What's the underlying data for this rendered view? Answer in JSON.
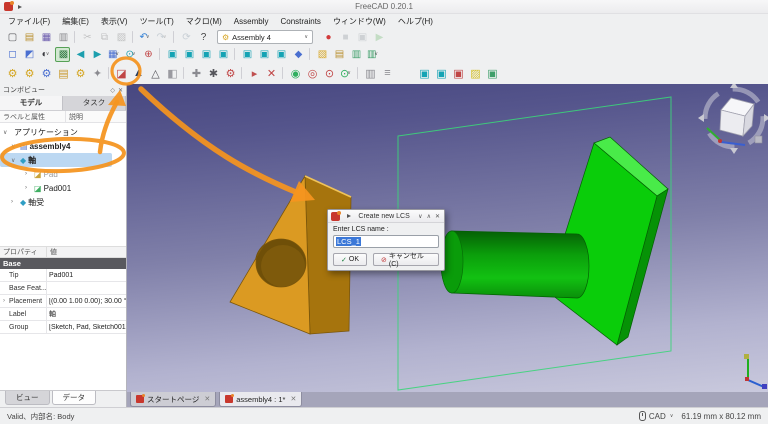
{
  "window": {
    "title": "FreeCAD 0.20.1"
  },
  "menu_bar": {
    "items": [
      {
        "name": "menu-file",
        "label": "ファイル(F)"
      },
      {
        "name": "menu-edit",
        "label": "編集(E)"
      },
      {
        "name": "menu-view",
        "label": "表示(V)"
      },
      {
        "name": "menu-tools",
        "label": "ツール(T)"
      },
      {
        "name": "menu-macro",
        "label": "マクロ(M)"
      },
      {
        "name": "menu-assembly",
        "label": "Assembly"
      },
      {
        "name": "menu-constraints",
        "label": "Constraints"
      },
      {
        "name": "menu-windows",
        "label": "ウィンドウ(W)"
      },
      {
        "name": "menu-help",
        "label": "ヘルプ(H)"
      }
    ]
  },
  "toolbars": {
    "workbench_selector": {
      "value": "Assembly 4",
      "icon_glyph": "⚙",
      "chevron": "∨"
    },
    "row1a": [
      {
        "name": "new-file-button",
        "glyph": "▢",
        "color": "#5a5a5e"
      },
      {
        "name": "open-file-button",
        "glyph": "▤",
        "color": "#b98f2e"
      },
      {
        "name": "save-button",
        "glyph": "▦",
        "color": "#6a5aad"
      },
      {
        "name": "print-button",
        "glyph": "▥",
        "color": "#8a8a8e"
      },
      {
        "cls": "tsep"
      },
      {
        "name": "cut-button",
        "glyph": "✂",
        "color": "#777777",
        "cls": "dim"
      },
      {
        "name": "copy-button",
        "glyph": "⧉",
        "color": "#777777",
        "cls": "dim"
      },
      {
        "name": "paste-button",
        "glyph": "▨",
        "color": "#777777",
        "cls": "dim"
      },
      {
        "cls": "tsep"
      },
      {
        "name": "undo-button",
        "glyph": "↶",
        "color": "#2f7fd6",
        "dd": "∨"
      },
      {
        "name": "redo-button",
        "glyph": "↷",
        "color": "#8a9aa8",
        "cls": "dim",
        "dd": "∨"
      },
      {
        "cls": "tsep"
      },
      {
        "name": "refresh-button",
        "glyph": "⟳",
        "color": "#8a9aa8",
        "cls": "dim"
      },
      {
        "name": "whats-this-button",
        "glyph": "?",
        "color": "#444444"
      }
    ],
    "row1b": [
      {
        "name": "macro-record-button",
        "glyph": "●",
        "color": "#d23b3b"
      },
      {
        "name": "macro-stop-button",
        "glyph": "■",
        "color": "#9aa0a6",
        "cls": "dim"
      },
      {
        "name": "macro-debug-button",
        "glyph": "▣",
        "color": "#9aa0a6",
        "cls": "dim"
      },
      {
        "name": "macro-play-button",
        "glyph": "▶",
        "color": "#7fbf7f",
        "cls": "dim"
      }
    ],
    "row2": [
      {
        "name": "box-selection-button",
        "glyph": "◻",
        "color": "#4a6fd0"
      },
      {
        "name": "box-element-selection-button",
        "glyph": "◩",
        "color": "#4a6fd0"
      },
      {
        "name": "draw-style-button",
        "glyph": "◐",
        "color": "#3a3a40",
        "dd": "∨"
      },
      {
        "name": "textured-view-button",
        "glyph": "▩",
        "color": "#3a7f4a",
        "cls": "isel"
      },
      {
        "name": "nav-back-button",
        "glyph": "◀",
        "color": "#1d9fae"
      },
      {
        "name": "nav-forward-button",
        "glyph": "▶",
        "color": "#1d9fae"
      },
      {
        "name": "nav-style-button",
        "glyph": "▦",
        "color": "#4a6fd0",
        "dd": "∨"
      },
      {
        "name": "zoom-button",
        "glyph": "⊙",
        "color": "#1d9fae",
        "dd": "∨"
      },
      {
        "name": "fit-all-button",
        "glyph": "⊕",
        "color": "#c04545"
      },
      {
        "cls": "tsep"
      },
      {
        "name": "view-axonometric-button",
        "glyph": "▣",
        "color": "#14a3b4"
      },
      {
        "name": "view-front-button",
        "glyph": "▣",
        "color": "#14a3b4"
      },
      {
        "name": "view-top-button",
        "glyph": "▣",
        "color": "#14a3b4"
      },
      {
        "name": "view-right-button",
        "glyph": "▣",
        "color": "#14a3b4"
      },
      {
        "cls": "tsep"
      },
      {
        "name": "view-rear-button",
        "glyph": "▣",
        "color": "#14a3b4"
      },
      {
        "name": "view-bottom-button",
        "glyph": "▣",
        "color": "#14a3b4"
      },
      {
        "name": "view-left-button",
        "glyph": "▣",
        "color": "#14a3b4"
      },
      {
        "name": "measure-button",
        "glyph": "◆",
        "color": "#4a6fd0"
      },
      {
        "cls": "tsep"
      },
      {
        "name": "create-part-button",
        "glyph": "▧",
        "color": "#d8a829"
      },
      {
        "name": "create-group-button",
        "glyph": "▤",
        "color": "#b98f2e"
      },
      {
        "name": "make-link-button",
        "glyph": "▥",
        "color": "#3f9f6a"
      },
      {
        "name": "make-sub-link-button",
        "glyph": "▥",
        "color": "#3f9f6a",
        "dd": "∨"
      }
    ],
    "row3": [
      {
        "name": "insert-link-button",
        "glyph": "⚙",
        "color": "#d4a51f"
      },
      {
        "name": "insert-part-button",
        "glyph": "⚙",
        "color": "#d4a51f"
      },
      {
        "name": "insert-fastener-button",
        "glyph": "⚙",
        "color": "#4a6fd0"
      },
      {
        "name": "open-document-button",
        "glyph": "▤",
        "color": "#c9992c"
      },
      {
        "name": "variant-link-button",
        "glyph": "⚙",
        "color": "#d4a51f"
      },
      {
        "name": "datum-point-button",
        "glyph": "✦",
        "color": "#8a8a90"
      },
      {
        "cls": "tsep"
      },
      {
        "name": "new-sketch-button",
        "glyph": "◪",
        "color": "#c04545"
      },
      {
        "name": "new-lcs-button",
        "glyph": "▲",
        "color": "#223a5e"
      },
      {
        "name": "placed-lcs-button",
        "glyph": "△",
        "color": "#55555b"
      },
      {
        "name": "datum-plane-button",
        "glyph": "◧",
        "color": "#9a9aa0"
      },
      {
        "cls": "tsep"
      },
      {
        "name": "move-part-button",
        "glyph": "✚",
        "color": "#8a8a90"
      },
      {
        "name": "attach-part-button",
        "glyph": "✱",
        "color": "#55555b"
      },
      {
        "name": "solve-constraints-button",
        "glyph": "⚙",
        "color": "#c04545"
      },
      {
        "cls": "tsep"
      },
      {
        "name": "animate-assembly-button",
        "glyph": "▸",
        "color": "#c05050"
      },
      {
        "name": "release-attachment-button",
        "glyph": "✕",
        "color": "#c04545"
      },
      {
        "cls": "tsep"
      },
      {
        "name": "show-lcs-button",
        "glyph": "◉",
        "color": "#2faf5f"
      },
      {
        "name": "hide-lcs-button",
        "glyph": "◎",
        "color": "#c04545"
      },
      {
        "name": "zoom-selection-button",
        "glyph": "⊙",
        "color": "#c04545"
      },
      {
        "name": "zoom-fit-button",
        "glyph": "⊙",
        "color": "#2faf5f",
        "dd": "∨"
      },
      {
        "cls": "tsep"
      },
      {
        "name": "bom-button",
        "glyph": "▥",
        "color": "#8a8a90"
      },
      {
        "name": "info-button",
        "glyph": "≡",
        "color": "#8a8a90"
      },
      {
        "cls": "tgap"
      },
      {
        "name": "part-workbench-button",
        "glyph": "▣",
        "color": "#14a3b4"
      },
      {
        "name": "body-create-button",
        "glyph": "▣",
        "color": "#14a3b4"
      },
      {
        "name": "primitive-cube-button",
        "glyph": "▣",
        "color": "#c04545"
      },
      {
        "name": "sketch-create-button",
        "glyph": "▨",
        "color": "#d4c12a"
      },
      {
        "name": "draft-button",
        "glyph": "▣",
        "color": "#3f9f6a"
      }
    ]
  },
  "combo_view": {
    "title": "コンボビュー",
    "float_glyph": "◇",
    "close_glyph": "✕",
    "tabs": [
      {
        "label": "モデル"
      },
      {
        "label": "タスク"
      }
    ],
    "tree_headers": [
      "ラベルと属性",
      "説明"
    ],
    "tree": [
      {
        "name": "tree-item-application",
        "label": "アプリケーション",
        "exp": "∨",
        "ig": "",
        "ic": "",
        "cls": "lv0"
      },
      {
        "name": "tree-item-assembly4",
        "label": "assembly4",
        "exp": "∨",
        "ig": "▤",
        "ic": "#5a78c8",
        "cls": "lv1 bold"
      },
      {
        "name": "tree-item-axis",
        "label": "軸",
        "exp": "∨",
        "ig": "◆",
        "ic": "#2f9ec4",
        "cls": "lv1 sel bold"
      },
      {
        "name": "tree-item-pad",
        "label": "Pad",
        "exp": "›",
        "ig": "◪",
        "ic": "#c8a43c",
        "cls": "lv2 dim"
      },
      {
        "name": "tree-item-pad001",
        "label": "Pad001",
        "exp": "›",
        "ig": "◪",
        "ic": "#3fae62",
        "cls": "lv2"
      },
      {
        "name": "tree-item-bearing",
        "label": "軸受",
        "exp": "›",
        "ig": "◆",
        "ic": "#2f9ec4",
        "cls": "lv1"
      }
    ],
    "property_headers": [
      "プロパティ",
      "値"
    ],
    "property_section": "Base",
    "properties": [
      {
        "name": "property-row-tip",
        "label": "Tip",
        "value": "Pad001",
        "exp": ""
      },
      {
        "name": "property-row-base-feature",
        "label": "Base Feat...",
        "value": "",
        "exp": ""
      },
      {
        "name": "property-row-placement",
        "label": "Placement",
        "value": "[(0.00 1.00 0.00); 30.00 °; (0...",
        "exp": "›"
      },
      {
        "name": "property-row-label",
        "label": "Label",
        "value": "軸",
        "exp": ""
      },
      {
        "name": "property-row-group",
        "label": "Group",
        "value": "[Sketch, Pad, Sketch001 ...]",
        "exp": ""
      }
    ],
    "bottom_tabs": [
      {
        "label": "ビュー"
      },
      {
        "label": "データ"
      }
    ]
  },
  "document_tabs": [
    {
      "label": "スタートページ",
      "close": "✕"
    },
    {
      "label": "assembly4 : 1*",
      "close": "✕"
    }
  ],
  "dialog": {
    "title": "Create new LCS",
    "prompt": "Enter LCS name :",
    "input_value": "LCS_1",
    "ok_label": "OK",
    "ok_glyph": "✓",
    "cancel_label": "キャンセル(C)",
    "cancel_glyph": "⊘",
    "shade_glyph": "∨",
    "unshade_glyph": "∧",
    "close_glyph": "✕"
  },
  "status_bar": {
    "validity": "Valid、内部名: Body",
    "nav_style": "CAD",
    "chevron": "∨",
    "dimensions": "61.19 mm x 80.12 mm"
  },
  "colors": {
    "annotation_orange": "#F5941F",
    "selection_blue": "#3B78D8",
    "tree_selection": "#BCD8F2",
    "viewport_top": "#474780",
    "viewport_bottom": "#C9C9DD",
    "part_orange": "#DB9A22",
    "part_green": "#0ACD0A",
    "wireframe_green": "#3BD579",
    "record_red": "#D23B3B",
    "teal_icon": "#14A3B4"
  }
}
